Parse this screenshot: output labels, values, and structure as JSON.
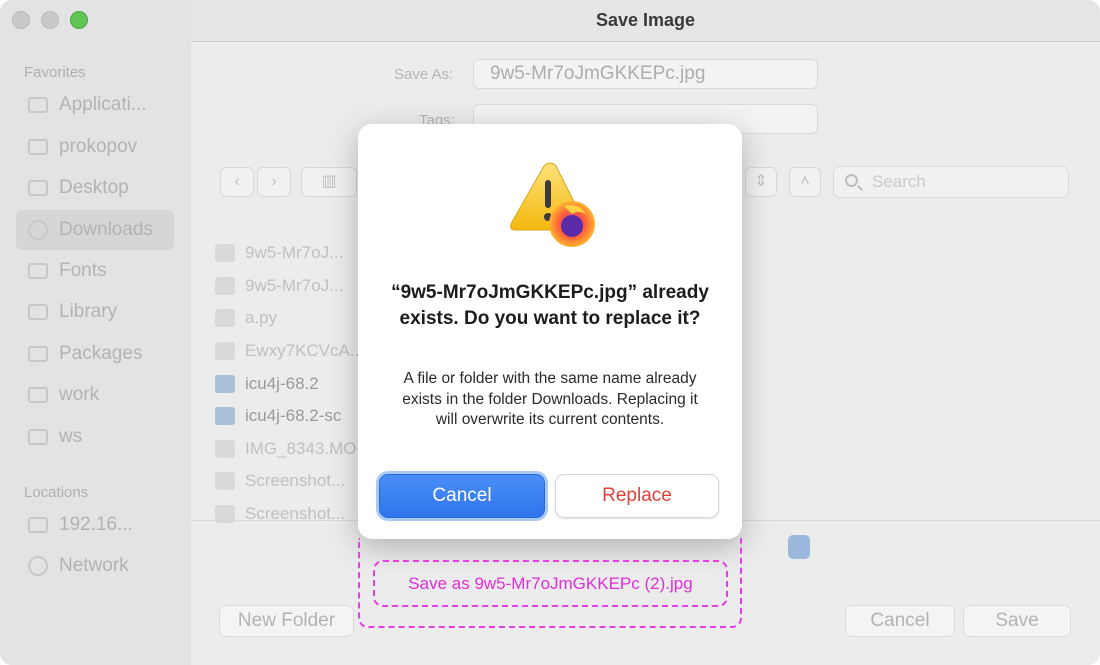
{
  "window": {
    "title": "Save Image"
  },
  "sidebar": {
    "favorites_header": "Favorites",
    "favorites": [
      {
        "label": "Applicati...",
        "icon": "applications-icon"
      },
      {
        "label": "prokopov",
        "icon": "home-icon"
      },
      {
        "label": "Desktop",
        "icon": "desktop-icon"
      },
      {
        "label": "Downloads",
        "icon": "downloads-icon"
      },
      {
        "label": "Fonts",
        "icon": "folder-icon"
      },
      {
        "label": "Library",
        "icon": "library-icon"
      },
      {
        "label": "Packages",
        "icon": "folder-icon"
      },
      {
        "label": "work",
        "icon": "folder-icon"
      },
      {
        "label": "ws",
        "icon": "folder-icon"
      }
    ],
    "locations_header": "Locations",
    "locations": [
      {
        "label": "192.16...",
        "icon": "computer-icon"
      },
      {
        "label": "Network",
        "icon": "network-icon"
      }
    ]
  },
  "form": {
    "save_as_label": "Save As:",
    "save_as_value": "9w5-Mr7oJmGKKEPc.jpg",
    "tags_label": "Tags:"
  },
  "toolbar": {
    "search_placeholder": "Search"
  },
  "files": [
    {
      "name": "9w5-Mr7oJ..."
    },
    {
      "name": "9w5-Mr7oJ..."
    },
    {
      "name": "a.py"
    },
    {
      "name": "Ewxy7KCVcA..."
    },
    {
      "name": "icu4j-68.2"
    },
    {
      "name": "icu4j-68.2-sc"
    },
    {
      "name": "IMG_8343.MO"
    },
    {
      "name": "Screenshot..."
    },
    {
      "name": "Screenshot..."
    }
  ],
  "bottom": {
    "new_folder_label": "New Folder",
    "cancel_label": "Cancel",
    "save_label": "Save"
  },
  "dialog": {
    "title": "“9w5-Mr7oJmGKKEPc.jpg” already exists. Do you want to replace it?",
    "message": "A file or folder with the same name already exists in the folder Downloads. Replacing it will overwrite its current contents.",
    "cancel_label": "Cancel",
    "replace_label": "Replace",
    "save_as_copy_label": "Save as 9w5-Mr7oJmGKKEPc (2).jpg"
  },
  "colors": {
    "accent": "#2f74ec",
    "destructive": "#e0413a",
    "highlight_dashed": "#e53ee3"
  }
}
